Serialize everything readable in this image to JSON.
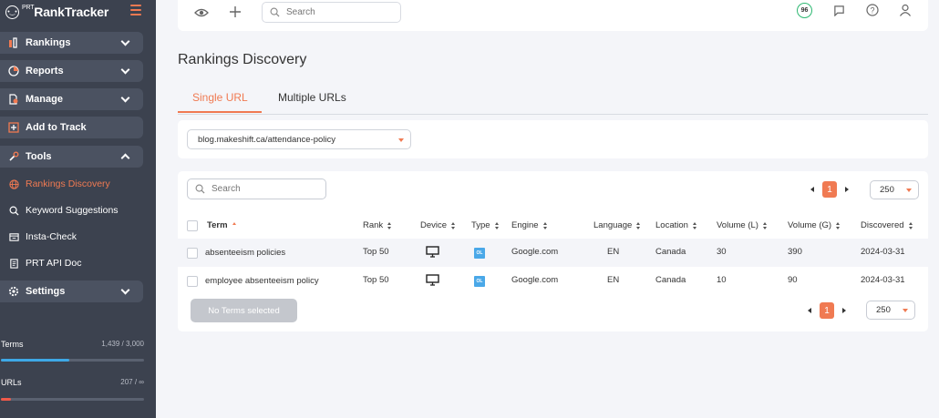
{
  "brand": {
    "name": "RankTracker",
    "prefix": "PRT",
    "accent": "#f07a52",
    "sidebar_bg": "#3c424f"
  },
  "sidebar": {
    "rankings": "Rankings",
    "reports": "Reports",
    "manage": "Manage",
    "add_to_track": "Add to Track",
    "tools": "Tools",
    "sub": {
      "rankings_discovery": "Rankings Discovery",
      "keyword_suggestions": "Keyword Suggestions",
      "insta_check": "Insta-Check",
      "prt_api_doc": "PRT API Doc"
    },
    "settings": "Settings",
    "terms": {
      "label": "Terms",
      "value": "1,439 / 3,000",
      "fraction": 0.48
    },
    "urls": {
      "label": "URLs",
      "value": "207 / ∞",
      "fraction": 0.07
    }
  },
  "topbar": {
    "search_placeholder": "Search",
    "score": "96"
  },
  "page": {
    "title": "Rankings Discovery",
    "tabs": {
      "single": "Single URL",
      "multiple": "Multiple URLs"
    },
    "url_value": "blog.makeshift.ca/attendance-policy"
  },
  "table": {
    "search_placeholder": "Search",
    "page": "1",
    "per_page": "250",
    "headers": {
      "term": "Term",
      "rank": "Rank",
      "device": "Device",
      "type": "Type",
      "engine": "Engine",
      "language": "Language",
      "location": "Location",
      "volume_l": "Volume (L)",
      "volume_g": "Volume (G)",
      "discovered": "Discovered"
    },
    "rows": [
      {
        "term": "absenteeism policies",
        "rank": "Top 50",
        "type": "OL",
        "engine": "Google.com",
        "language": "EN",
        "location": "Canada",
        "volume_l": "30",
        "volume_g": "390",
        "discovered": "2024-03-31"
      },
      {
        "term": "employee absenteeism policy",
        "rank": "Top 50",
        "type": "OL",
        "engine": "Google.com",
        "language": "EN",
        "location": "Canada",
        "volume_l": "10",
        "volume_g": "90",
        "discovered": "2024-03-31"
      }
    ],
    "no_terms_button": "No Terms selected"
  }
}
